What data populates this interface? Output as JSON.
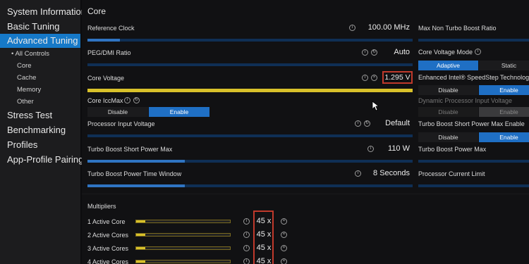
{
  "sidebar": {
    "items": [
      {
        "label": "System Information"
      },
      {
        "label": "Basic Tuning"
      },
      {
        "label": "Advanced Tuning"
      },
      {
        "label": "All Controls"
      },
      {
        "label": "Core"
      },
      {
        "label": "Cache"
      },
      {
        "label": "Memory"
      },
      {
        "label": "Other"
      },
      {
        "label": "Stress Test"
      },
      {
        "label": "Benchmarking"
      },
      {
        "label": "Profiles"
      },
      {
        "label": "App-Profile Pairing"
      }
    ]
  },
  "main": {
    "title": "Core",
    "reference_clock": {
      "label": "Reference Clock",
      "value": "100.00 MHz",
      "level": 0.1
    },
    "peg_dmi": {
      "label": "PEG/DMI Ratio",
      "value": "Auto",
      "level": 0
    },
    "core_voltage": {
      "label": "Core Voltage",
      "value": "1.295 V",
      "level": 1.0
    },
    "core_iccmax": {
      "label": "Core IccMax",
      "options": [
        "Disable",
        "Enable"
      ],
      "selected": "Enable"
    },
    "processor_input_voltage": {
      "label": "Processor Input Voltage",
      "value": "Default",
      "level": 0
    },
    "turbo_short_max": {
      "label": "Turbo Boost Short Power Max",
      "value": "110 W",
      "level": 0.3
    },
    "turbo_time_window": {
      "label": "Turbo Boost Power Time Window",
      "value": "8 Seconds",
      "level": 0.3
    },
    "multipliers": {
      "title": "Multipliers",
      "rows": [
        {
          "label": "1 Active Core",
          "value": "45 x",
          "level": 0.1
        },
        {
          "label": "2 Active Cores",
          "value": "45 x",
          "level": 0.1
        },
        {
          "label": "3 Active Cores",
          "value": "45 x",
          "level": 0.1
        },
        {
          "label": "4 Active Cores",
          "value": "45 x",
          "level": 0.1
        }
      ]
    }
  },
  "right": {
    "max_non_turbo": {
      "label": "Max Non Turbo Boost Ratio"
    },
    "core_voltage_mode": {
      "label": "Core Voltage Mode",
      "options": [
        "Adaptive",
        "Static"
      ],
      "selected": "Adaptive"
    },
    "speedstep": {
      "label": "Enhanced Intel® SpeedStep Technology",
      "options": [
        "Disable",
        "Enable"
      ],
      "selected": "Enable"
    },
    "dynamic_piv": {
      "label": "Dynamic Processor Input Voltage",
      "options": [
        "Disable",
        "Enable"
      ],
      "selected": "Enable"
    },
    "turbo_short_enable": {
      "label": "Turbo Boost Short Power Max Enable",
      "options": [
        "Disable",
        "Enable"
      ],
      "selected": "Enable"
    },
    "turbo_power_max": {
      "label": "Turbo Boost Power Max"
    },
    "current_limit": {
      "label": "Processor Current Limit"
    }
  },
  "colors": {
    "accent": "#1679c8",
    "highlight": "#c0392b",
    "voltage": "#d8c12a"
  },
  "icons": [
    "info-icon",
    "reset-icon",
    "close-icon",
    "mouse-cursor-icon"
  ]
}
